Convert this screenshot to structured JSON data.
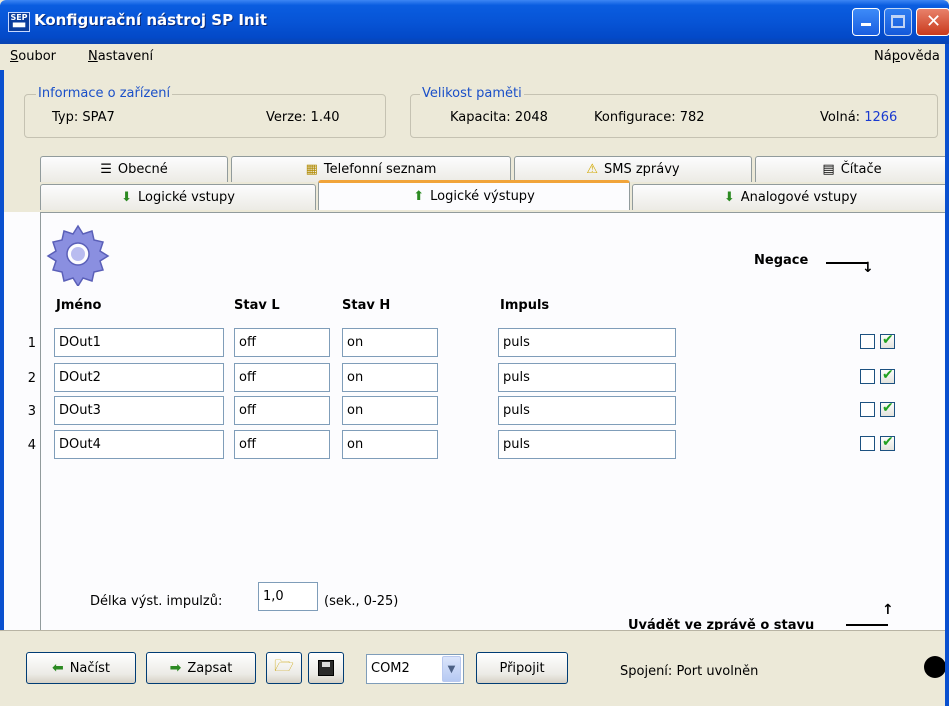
{
  "window": {
    "title": "Konfigurační nástroj SP Init",
    "icon_name": "sep-app-icon"
  },
  "menu": {
    "items": [
      {
        "name": "menu-soubor",
        "label_u": "S",
        "label_rest": "oubor"
      },
      {
        "name": "menu-nastaveni",
        "label_u": "N",
        "label_rest": "astavení"
      }
    ],
    "help": {
      "label_pre": "Ná",
      "label_u": "p",
      "label_rest": "ověda"
    }
  },
  "device_info": {
    "legend": "Informace o zařízení",
    "type_label": "Typ: SPA7",
    "version_label": "Verze: 1.40"
  },
  "memory": {
    "legend": "Velikost paměti",
    "capacity_label": "Kapacita: 2048",
    "config_label": "Konfigurace: 782",
    "free_label": "Volná:",
    "free_value": "1266",
    "free_color": "#1a3ad0"
  },
  "tabs_row1": [
    {
      "label": "Obecné",
      "icon": "list-icon",
      "glyph": "☰"
    },
    {
      "label": "Telefonní seznam",
      "icon": "keypad-icon",
      "glyph": "▦"
    },
    {
      "label": "SMS zprávy",
      "icon": "warning-icon",
      "glyph": "⚠"
    },
    {
      "label": "Čítače",
      "icon": "counter-icon",
      "glyph": "▤"
    }
  ],
  "tabs_row2": [
    {
      "label": "Logické vstupy",
      "icon": "input-icon",
      "glyph": "⬇"
    },
    {
      "label": "Logické výstupy",
      "icon": "output-icon",
      "glyph": "⬆",
      "active": true
    },
    {
      "label": "Analogové vstupy",
      "icon": "analog-icon",
      "glyph": "⬇"
    }
  ],
  "outputs": {
    "headers": {
      "name": "Jméno",
      "state_l": "Stav L",
      "state_h": "Stav H",
      "impulse": "Impuls"
    },
    "negation_label": "Negace",
    "rows": [
      {
        "num": "1",
        "name": "DOut1",
        "state_l": "off",
        "state_h": "on",
        "impulse": "puls",
        "negate": false,
        "report": true
      },
      {
        "num": "2",
        "name": "DOut2",
        "state_l": "off",
        "state_h": "on",
        "impulse": "puls",
        "negate": false,
        "report": true
      },
      {
        "num": "3",
        "name": "DOut3",
        "state_l": "off",
        "state_h": "on",
        "impulse": "puls",
        "negate": false,
        "report": true
      },
      {
        "num": "4",
        "name": "DOut4",
        "state_l": "off",
        "state_h": "on",
        "impulse": "puls",
        "negate": false,
        "report": true
      }
    ],
    "impulse_length_label": "Délka výst. impulzů:",
    "impulse_length_value": "1,0",
    "impulse_length_unit": "(sek., 0-25)",
    "report_label": "Uvádět ve zprávě o stavu"
  },
  "bottom": {
    "load_label": "Načíst",
    "write_label": "Zapsat",
    "port_value": "COM2",
    "connect_label": "Připojit",
    "connection_label": "Spojení:",
    "connection_status": "Port uvolněn",
    "status_color": "#000000"
  }
}
